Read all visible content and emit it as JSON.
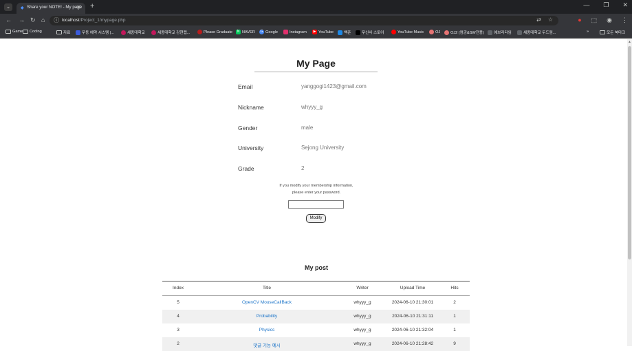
{
  "browser": {
    "tab_title": "Share your NOTE! - My page",
    "tab_favicon": "favicon-icon",
    "url_host": "localhost",
    "url_path": "/Project_1/mypage.php",
    "bookmarks": [
      {
        "label": "Game",
        "type": "folder"
      },
      {
        "label": "Coding",
        "type": "folder"
      },
      {
        "label": "자료",
        "type": "folder"
      },
      {
        "label": "우동 예약 시스템 |...",
        "type": "site",
        "color": "#3b5bdb"
      },
      {
        "label": "세종대학교",
        "type": "site",
        "color": "#c2185b"
      },
      {
        "label": "세종대학교 강현랩...",
        "type": "site",
        "color": "#c2185b"
      },
      {
        "label": "Please Graduate",
        "type": "site",
        "color": "#b71c1c"
      },
      {
        "label": "NAVER",
        "type": "site",
        "color": "#03c75a"
      },
      {
        "label": "Google",
        "type": "site",
        "color": "#4285f4"
      },
      {
        "label": "Instagram",
        "type": "site",
        "color": "#e1306c"
      },
      {
        "label": "YouTube",
        "type": "site",
        "color": "#ff0000"
      },
      {
        "label": "백준",
        "type": "site",
        "color": "#1e88e5"
      },
      {
        "label": "무신사 스토어",
        "type": "site",
        "color": "#000000"
      },
      {
        "label": "YouTube Music",
        "type": "site",
        "color": "#ff0000"
      },
      {
        "label": "OJ",
        "type": "site",
        "color": "#e57373"
      },
      {
        "label": "OJ2 (컴공&SW전용)",
        "type": "site",
        "color": "#e57373"
      },
      {
        "label": "에브리타임",
        "type": "site",
        "color": "#5f6368"
      },
      {
        "label": "세종대학교 두드림...",
        "type": "site",
        "color": "#5f6368"
      }
    ],
    "bookmarks_more": "»",
    "all_bookmarks": "모든 북마크"
  },
  "mypage": {
    "title": "My Page",
    "fields": [
      {
        "label": "Email",
        "value": "yanggogi1423@gmail.com"
      },
      {
        "label": "Nickname",
        "value": "whyyy_g"
      },
      {
        "label": "Gender",
        "value": "male"
      },
      {
        "label": "University",
        "value": "Sejong University"
      },
      {
        "label": "Grade",
        "value": "2"
      }
    ],
    "note_line1": "If you modify your membership information,",
    "note_line2": "please enter your password.",
    "password_value": "",
    "modify_label": "Modify"
  },
  "mypost": {
    "title": "My post",
    "headers": {
      "index": "Index",
      "title": "Title",
      "writer": "Writer",
      "time": "Upload Time",
      "hits": "Hits"
    },
    "rows": [
      {
        "index": "5",
        "title": "OpenCV MouseCallBack",
        "writer": "whyyy_g",
        "time": "2024-06-10 21:30:01",
        "hits": "2"
      },
      {
        "index": "4",
        "title": "Probability",
        "writer": "whyyy_g",
        "time": "2024-06-10 21:31:11",
        "hits": "1"
      },
      {
        "index": "3",
        "title": "Physics",
        "writer": "whyyy_g",
        "time": "2024-06-10 21:32:04",
        "hits": "1"
      },
      {
        "index": "2",
        "title": "댓글 기능 예시",
        "writer": "whyyy_g",
        "time": "2024-06-10 21:28:42",
        "hits": "9"
      }
    ]
  },
  "colors": {
    "link": "#1a73c8",
    "row_alt": "#f0f0f0",
    "chrome_dark": "#202124",
    "chrome": "#35363a"
  }
}
